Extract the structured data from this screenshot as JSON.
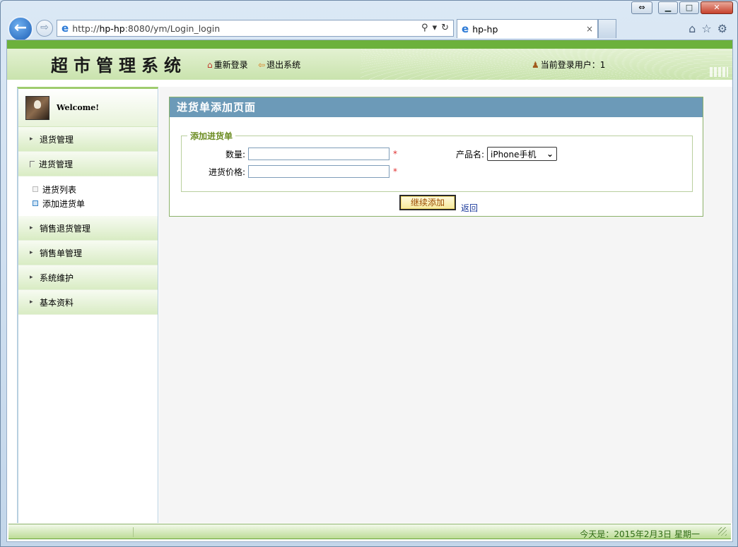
{
  "browser": {
    "url_prefix": "http://",
    "url_host": "hp-hp",
    "url_rest": ":8080/ym/Login_login",
    "tab_title": "hp-hp",
    "tab_close": "×",
    "search_glyph": "⚲",
    "dropdown_glyph": "▾",
    "refresh_glyph": "↻",
    "back_glyph": "←",
    "forward_glyph": "⇨",
    "restore_glyph": "⇔",
    "minimize_glyph": "▁",
    "maximize_glyph": "□",
    "close_glyph": "✕",
    "ie_glyph": "e",
    "home_glyph": "⌂",
    "favorites_glyph": "☆",
    "tools_glyph": "⚙"
  },
  "header": {
    "title": "超市管理系统",
    "relogin": "重新登录",
    "logout": "退出系统",
    "current_user_label": "当前登录用户：1",
    "home_icon_glyph": "⌂",
    "exit_icon_glyph": "⇦",
    "user_icon_glyph": "♟"
  },
  "sidebar": {
    "welcome": "Welcome!",
    "menu": [
      {
        "label": "退货管理",
        "marker": "▸"
      },
      {
        "label": "进货管理",
        "marker": ""
      },
      {
        "label": "销售退货管理",
        "marker": "▸"
      },
      {
        "label": "销售单管理",
        "marker": "▸"
      },
      {
        "label": "系统维护",
        "marker": "▸"
      },
      {
        "label": "基本资料",
        "marker": "▸"
      }
    ],
    "submenu": [
      {
        "label": "进货列表",
        "active": false
      },
      {
        "label": "添加进货单",
        "active": true
      }
    ]
  },
  "main": {
    "panel_title": "进货单添加页面",
    "fieldset_legend": "添加进货单",
    "quantity_label": "数量:",
    "quantity_value": "",
    "price_label": "进货价格:",
    "price_value": "",
    "product_label": "产品名:",
    "product_selected": "iPhone手机",
    "required_mark": "*",
    "continue_button": "继续添加",
    "back_link": "返回"
  },
  "footer": {
    "date_text": "今天是：2015年2月3日 星期一"
  },
  "colors": {
    "header_green": "#6cb13c",
    "panel_title_blue": "#6c9ab8",
    "legend_green": "#6b8c22",
    "required_red": "#e03030",
    "button_text": "#9a4a00"
  }
}
